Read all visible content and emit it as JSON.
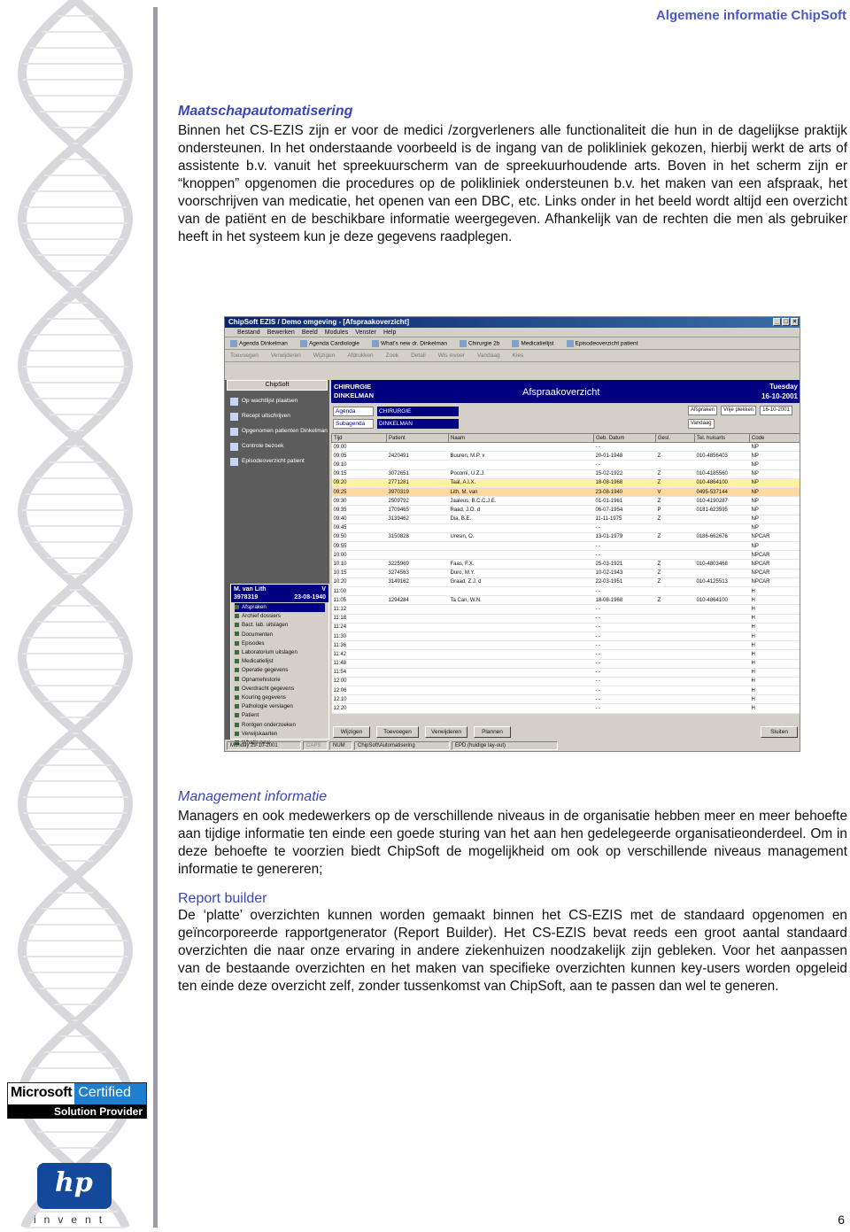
{
  "header": {
    "title": "Algemene informatie ChipSoft"
  },
  "section1": {
    "title": "Maatschapautomatisering",
    "body": "Binnen het CS-EZIS zijn er voor de medici /zorgverleners alle functionaliteit die hun in de dagelijkse praktijk ondersteunen. In het onderstaande voorbeeld is de ingang van de polikliniek gekozen, hierbij werkt de arts of assistente b.v. vanuit het spreekuurscherm van de spreekuurhoudende arts. Boven in het scherm zijn er “knoppen” opgenomen die procedures op de polikliniek ondersteunen b.v. het maken van een afspraak, het voorschrijven van medicatie, het openen van een DBC, etc. Links onder in het beeld wordt altijd een overzicht van de patiënt en de beschikbare informatie weergegeven. Afhankelijk van de rechten die men als gebruiker heeft in het systeem kun je deze gegevens raadplegen."
  },
  "screenshot": {
    "window_title": "ChipSoft EZIS / Demo omgeving - [Afspraakoverzicht]",
    "menu": [
      "Bestand",
      "Bewerken",
      "Beeld",
      "Modules",
      "Venster",
      "Help"
    ],
    "shortcuts": [
      "Agenda Dinkelman",
      "Agenda Cardiologie",
      "What's new dr. Dinkelman",
      "Chirurgie 2b",
      "Medicatielijst",
      "Episodeoverzicht patient"
    ],
    "toolbar": [
      "Toevoegen",
      "Verwijderen",
      "Wijzigen",
      "Afdrukken",
      "Zoek",
      "Detail",
      "Wis invoer",
      "Vandaag",
      "Kies"
    ],
    "chipsoft_label": "ChipSoft",
    "actions": [
      "Op wachtlijst plaatsen",
      "Recept uitschrijven",
      "Opgenomen patienten Dinkelman",
      "Controle bezoek",
      "Episodeoverzicht patient"
    ],
    "patient": {
      "name": "M. van Lith",
      "sex": "V",
      "number": "3978319",
      "dob": "23-08-1940",
      "items": [
        "Afspraken",
        "Archief dossiers",
        "Bact. lab. uitslagen",
        "Documenten",
        "Episodes",
        "Laboratorium uitslagen",
        "Medicatielijst",
        "Operatie gegevens",
        "Opnamehistorie",
        "Overdracht gegevens",
        "Kouring gegevens",
        "Pathologie verslagen",
        "Patient",
        "Rontgen onderzoeken",
        "Verwijskaarten",
        "What's new"
      ]
    },
    "specialism": {
      "line1": "CHIRURGIE",
      "line2": "DINKELMAN",
      "title": "Afspraakoverzicht",
      "day": "Tuesday",
      "date": "16-10-2001"
    },
    "filters": {
      "agenda_label": "Agenda",
      "agenda_value": "CHIRURGIE",
      "subagenda_label": "Subagenda",
      "subagenda_value": "DINKELMAN",
      "right": [
        "Afspraken",
        "Vrije plekken",
        "16-10-2001",
        "Vandaag"
      ]
    },
    "columns": [
      "Tijd",
      "Patient",
      "Naam",
      "Geb. Datum",
      "Gesl.",
      "Tel. huisarts",
      "Code"
    ],
    "rows": [
      [
        "09:00",
        "",
        "",
        "- -",
        "",
        "",
        "NP"
      ],
      [
        "09:05",
        "2420491",
        "Buuren, M.P. v",
        "20-01-1948",
        "Z",
        "010-4856403",
        "NP"
      ],
      [
        "09:10",
        "",
        "",
        "- -",
        "",
        "",
        "NP"
      ],
      [
        "09:15",
        "3072651",
        "Pocomi, U.Z.J.",
        "15-02-1922",
        "Z",
        "010-4185560",
        "NP"
      ],
      [
        "09:20",
        "2771281",
        "Taal, A.I.X.",
        "18-08-1968",
        "Z",
        "010-4864100",
        "NP"
      ],
      [
        "09:25",
        "3970319",
        "Lith, M. van",
        "23-08-1940",
        "V",
        "0495-537144",
        "NP"
      ],
      [
        "09:30",
        "2509792",
        "Jaaleus, B.C.C.J.E.",
        "01-01-1961",
        "Z",
        "010-4190287",
        "NP"
      ],
      [
        "09:35",
        "1709465",
        "Raad, J.O. d",
        "06-07-1954",
        "P",
        "0181-623595",
        "NP"
      ],
      [
        "09:40",
        "3139462",
        "Dia, B.E.",
        "11-11-1975",
        "Z",
        "",
        "NP"
      ],
      [
        "09:45",
        "",
        "",
        "- -",
        "",
        "",
        "NP"
      ],
      [
        "09:50",
        "3150828",
        "Uresin, O.",
        "13-01-1979",
        "Z",
        "0186-662676",
        "NPCAR"
      ],
      [
        "09:55",
        "",
        "",
        "- -",
        "",
        "",
        "NP"
      ],
      [
        "10:00",
        "",
        "",
        "- -",
        "",
        "",
        "NPCAR"
      ],
      [
        "10:10",
        "3225969",
        "Faas, F.X.",
        "25-03-1921",
        "Z",
        "010-4803468",
        "NPCAR"
      ],
      [
        "10:15",
        "3274563",
        "Duro, M.Y.",
        "10-02-1943",
        "Z",
        "",
        "NPCAR"
      ],
      [
        "10:20",
        "3149162",
        "Graad, Z.J. d",
        "22-03-1951",
        "Z",
        "010-4125513",
        "NPCAR"
      ],
      [
        "11:00",
        "",
        "",
        "- -",
        "",
        "",
        "H"
      ],
      [
        "11:05",
        "1294284",
        "Ta Can, W.N.",
        "18-08-1968",
        "Z",
        "010-4864100",
        "H"
      ],
      [
        "11:12",
        "",
        "",
        "- -",
        "",
        "",
        "H"
      ],
      [
        "11:18",
        "",
        "",
        "- -",
        "",
        "",
        "H"
      ],
      [
        "11:24",
        "",
        "",
        "- -",
        "",
        "",
        "H"
      ],
      [
        "11:30",
        "",
        "",
        "- -",
        "",
        "",
        "H"
      ],
      [
        "11:36",
        "",
        "",
        "- -",
        "",
        "",
        "H"
      ],
      [
        "11:42",
        "",
        "",
        "- -",
        "",
        "",
        "H"
      ],
      [
        "11:48",
        "",
        "",
        "- -",
        "",
        "",
        "H"
      ],
      [
        "11:54",
        "",
        "",
        "- -",
        "",
        "",
        "H"
      ],
      [
        "12:00",
        "",
        "",
        "- -",
        "",
        "",
        "H"
      ],
      [
        "12:06",
        "",
        "",
        "- -",
        "",
        "",
        "H"
      ],
      [
        "12:10",
        "",
        "",
        "- -",
        "",
        "",
        "H"
      ],
      [
        "12:20",
        "",
        "",
        "- -",
        "",
        "",
        "H"
      ]
    ],
    "buttons": [
      "Wijzigen",
      "Toevoegen",
      "Verwijderen",
      "Plannen",
      "Sluiten"
    ],
    "status": [
      "Monday 29-10-2001",
      "CAPS",
      "NUM",
      "ChipSoft\\Automatisering",
      "EPD (huidige lay-out)"
    ]
  },
  "section2": {
    "title": "Management informatie",
    "body": "Managers en ook medewerkers op de verschillende niveaus in de organisatie hebben meer en meer behoefte aan tijdige informatie ten einde een goede sturing van het aan hen gedelegeerde organisatieonderdeel. Om in deze behoefte te voorzien biedt ChipSoft de mogelijkheid om ook op verschillende niveaus management informatie te genereren;",
    "subtitle": "Report builder",
    "body2": "De ‘platte’ overzichten kunnen worden gemaakt binnen het CS-EZIS met de standaard opgenomen en geïncorporeerde rapportgenerator (Report Builder). Het CS-EZIS bevat reeds een groot aantal standaard overzichten die naar onze ervaring in andere ziekenhuizen noodzakelijk zijn gebleken. Voor het aanpassen van de bestaande overzichten en het maken van specifieke overzichten kunnen key-users worden opgeleid ten einde deze overzicht zelf, zonder tussenkomst van ChipSoft, aan te passen dan wel te generen."
  },
  "logos": {
    "ms_name": "Microsoft",
    "ms_certified": "Certified",
    "ms_provider": "Solution Provider",
    "hp": "hp",
    "hp_invent": "invent"
  },
  "footer": {
    "page_number": "6"
  }
}
